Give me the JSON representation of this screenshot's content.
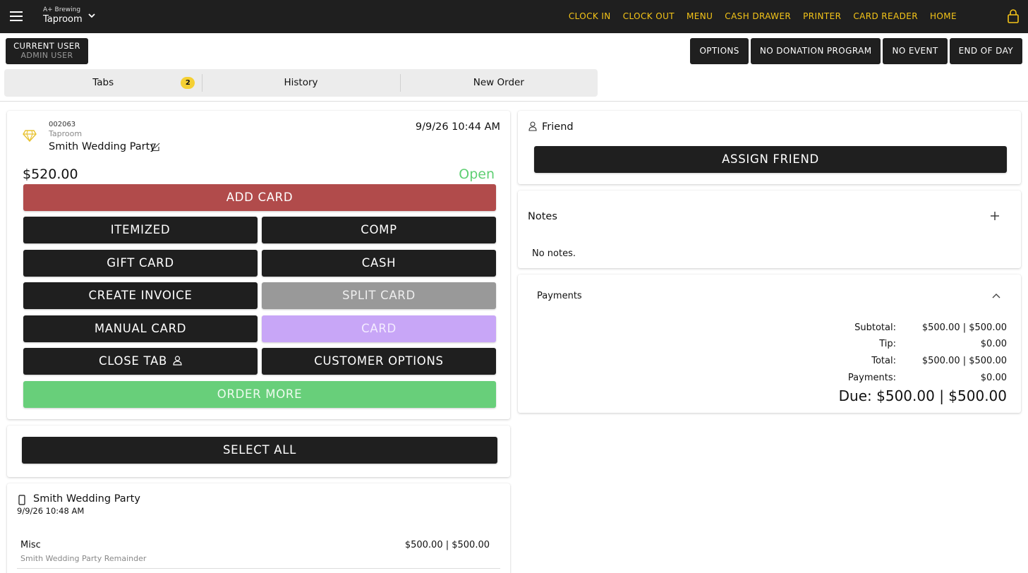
{
  "topbar": {
    "company": "A+ Brewing",
    "location": "Taproom",
    "nav": [
      "CLOCK IN",
      "CLOCK OUT",
      "MENU",
      "CASH DRAWER",
      "PRINTER",
      "CARD READER",
      "HOME"
    ]
  },
  "user": {
    "label": "CURRENT USER",
    "value": "ADMIN USER"
  },
  "top_actions": [
    "OPTIONS",
    "NO DONATION PROGRAM",
    "NO EVENT",
    "END OF DAY"
  ],
  "tabs": [
    {
      "label": "Tabs",
      "badge": "2"
    },
    {
      "label": "History"
    },
    {
      "label": "New Order"
    }
  ],
  "order": {
    "number": "002063",
    "location": "Taproom",
    "name": "Smith Wedding Party",
    "datetime": "9/9/26 10:44 AM",
    "total": "$520.00",
    "status": "Open",
    "buttons": {
      "add_card": "ADD CARD",
      "itemized": "ITEMIZED",
      "comp": "COMP",
      "gift_card": "GIFT CARD",
      "cash": "CASH",
      "create_invoice": "CREATE INVOICE",
      "split_card": "SPLIT CARD",
      "manual_card": "MANUAL CARD",
      "card": "CARD",
      "close_tab": "CLOSE TAB",
      "customer_options": "CUSTOMER OPTIONS",
      "order_more": "ORDER MORE"
    }
  },
  "select_all": "SELECT ALL",
  "items": {
    "group_name": "Smith Wedding Party",
    "group_date": "9/9/26 10:48 AM",
    "rows": [
      {
        "name": "Misc",
        "price": "$500.00 | $500.00",
        "desc": "Smith Wedding Party Remainder"
      }
    ]
  },
  "friend": {
    "label": "Friend",
    "button": "ASSIGN FRIEND"
  },
  "notes": {
    "title": "Notes",
    "empty": "No notes."
  },
  "payments": {
    "title": "Payments",
    "subtotal_label": "Subtotal:",
    "subtotal": "$500.00 | $500.00",
    "tip_label": "Tip:",
    "tip": "$0.00",
    "total_label": "Total:",
    "total": "$500.00 | $500.00",
    "payments_label": "Payments:",
    "payments": "$0.00",
    "due": "Due: $500.00 | $500.00"
  },
  "colors": {
    "nav_text": "#f5c518",
    "dark": "#1f1f1f",
    "add_card": "#b14b4b",
    "open_status": "#5fcf73",
    "order_more": "#68cf7a",
    "card_disabled": "#c8a6f7",
    "split_disabled": "#999999",
    "badge": "#f5d033"
  }
}
